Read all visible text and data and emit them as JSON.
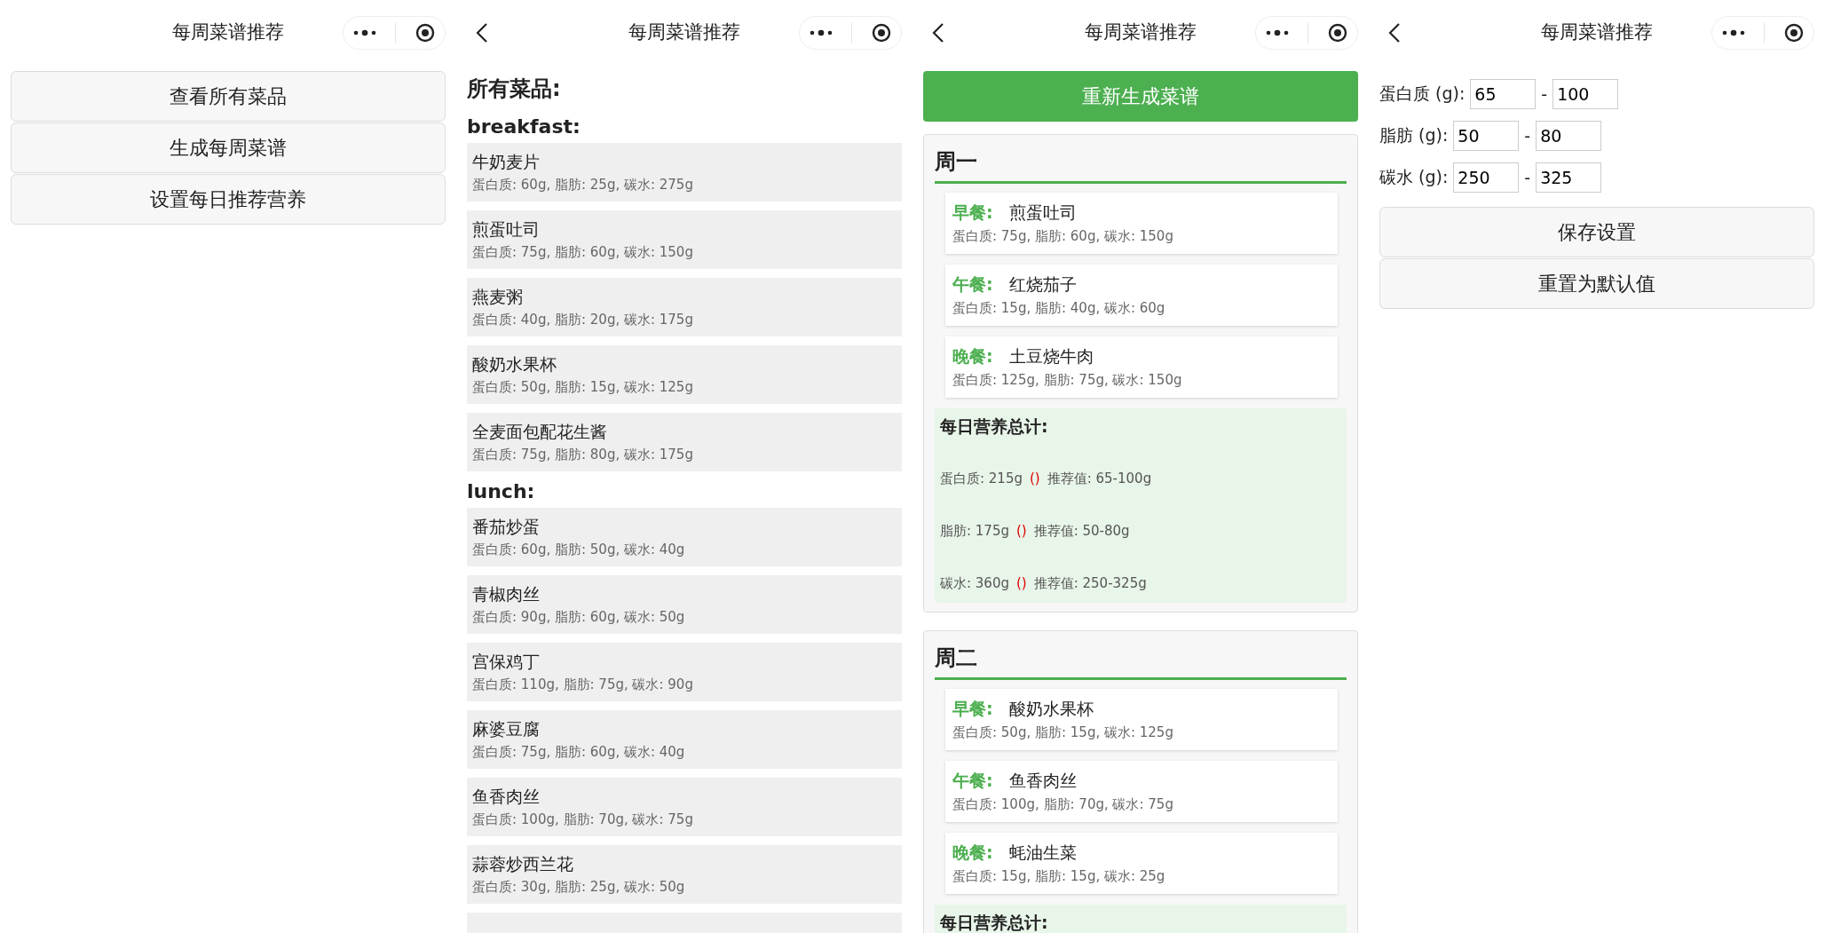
{
  "panels": [
    {
      "kind": "menu",
      "nav": {
        "title": "每周菜谱推荐",
        "back": false
      },
      "buttons": [
        "查看所有菜品",
        "生成每周菜谱",
        "设置每日推荐营养"
      ]
    },
    {
      "kind": "dishes",
      "nav": {
        "title": "每周菜谱推荐",
        "back": true
      },
      "heading": "所有菜品:",
      "groups": [
        {
          "name": "breakfast:",
          "dishes": [
            {
              "name": "牛奶麦片",
              "macros": "蛋白质: 60g, 脂肪: 25g, 碳水: 275g"
            },
            {
              "name": "煎蛋吐司",
              "macros": "蛋白质: 75g, 脂肪: 60g, 碳水: 150g"
            },
            {
              "name": "燕麦粥",
              "macros": "蛋白质: 40g, 脂肪: 20g, 碳水: 175g"
            },
            {
              "name": "酸奶水果杯",
              "macros": "蛋白质: 50g, 脂肪: 15g, 碳水: 125g"
            },
            {
              "name": "全麦面包配花生酱",
              "macros": "蛋白质: 75g, 脂肪: 80g, 碳水: 175g"
            }
          ]
        },
        {
          "name": "lunch:",
          "dishes": [
            {
              "name": "番茄炒蛋",
              "macros": "蛋白质: 60g, 脂肪: 50g, 碳水: 40g"
            },
            {
              "name": "青椒肉丝",
              "macros": "蛋白质: 90g, 脂肪: 60g, 碳水: 50g"
            },
            {
              "name": "宫保鸡丁",
              "macros": "蛋白质: 110g, 脂肪: 75g, 碳水: 90g"
            },
            {
              "name": "麻婆豆腐",
              "macros": "蛋白质: 75g, 脂肪: 60g, 碳水: 40g"
            },
            {
              "name": "鱼香肉丝",
              "macros": "蛋白质: 100g, 脂肪: 70g, 碳水: 75g"
            },
            {
              "name": "蒜蓉炒西兰花",
              "macros": "蛋白质: 30g, 脂肪: 25g, 碳水: 50g"
            }
          ]
        }
      ]
    },
    {
      "kind": "plan",
      "nav": {
        "title": "每周菜谱推荐",
        "back": true
      },
      "button": "重新生成菜谱",
      "days": [
        {
          "name": "周一",
          "meals": [
            {
              "label": "早餐:",
              "dish": "煎蛋吐司",
              "macros": "蛋白质: 75g, 脂肪: 60g, 碳水: 150g"
            },
            {
              "label": "午餐:",
              "dish": "红烧茄子",
              "macros": "蛋白质: 15g, 脂肪: 40g, 碳水: 60g"
            },
            {
              "label": "晚餐:",
              "dish": "土豆烧牛肉",
              "macros": "蛋白质: 125g, 脂肪: 75g, 碳水: 150g"
            }
          ],
          "summary": {
            "title": "每日营养总计:",
            "rows": [
              {
                "value": "蛋白质: 215g",
                "flag": "()",
                "recommended": "推荐值: 65-100g"
              },
              {
                "value": "脂肪: 175g",
                "flag": "()",
                "recommended": "推荐值: 50-80g"
              },
              {
                "value": "碳水: 360g",
                "flag": "()",
                "recommended": "推荐值: 250-325g"
              }
            ]
          }
        },
        {
          "name": "周二",
          "meals": [
            {
              "label": "早餐:",
              "dish": "酸奶水果杯",
              "macros": "蛋白质: 50g, 脂肪: 15g, 碳水: 125g"
            },
            {
              "label": "午餐:",
              "dish": "鱼香肉丝",
              "macros": "蛋白质: 100g, 脂肪: 70g, 碳水: 75g"
            },
            {
              "label": "晚餐:",
              "dish": "蚝油生菜",
              "macros": "蛋白质: 15g, 脂肪: 15g, 碳水: 25g"
            }
          ],
          "summary": {
            "title": "每日营养总计:"
          }
        }
      ]
    },
    {
      "kind": "settings",
      "nav": {
        "title": "每周菜谱推荐",
        "back": true
      },
      "fields": [
        {
          "label": "蛋白质 (g):",
          "min": "65",
          "separator": "-",
          "max": "100"
        },
        {
          "label": "脂肪 (g):",
          "min": "50",
          "separator": "-",
          "max": "80"
        },
        {
          "label": "碳水 (g):",
          "min": "250",
          "separator": "-",
          "max": "325"
        }
      ],
      "buttons": [
        "保存设置",
        "重置为默认值"
      ]
    }
  ]
}
